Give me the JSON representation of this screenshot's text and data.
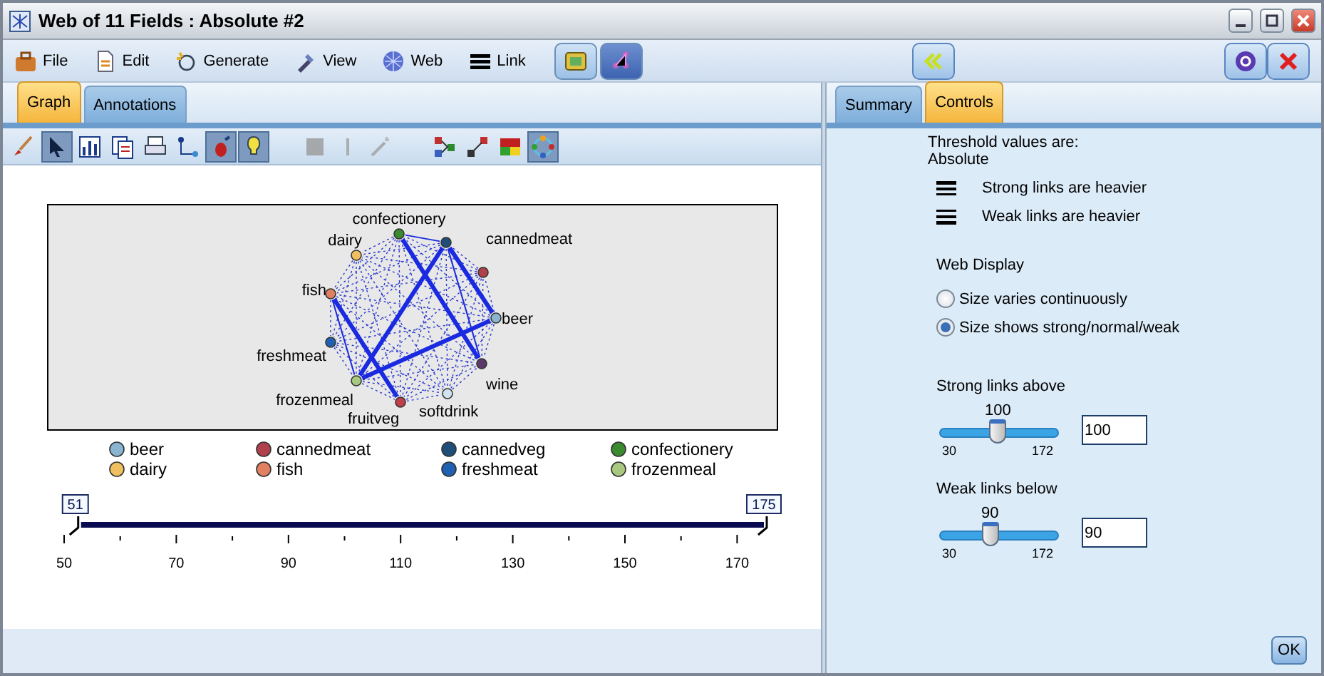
{
  "window": {
    "title": "Web of 11 Fields : Absolute #2"
  },
  "menu": [
    {
      "label": "File"
    },
    {
      "label": "Edit"
    },
    {
      "label": "Generate"
    },
    {
      "label": "View"
    },
    {
      "label": "Web"
    },
    {
      "label": "Link"
    }
  ],
  "mode_buttons": [
    {
      "selected": false
    },
    {
      "selected": true
    }
  ],
  "left_tabs": [
    {
      "label": "Graph",
      "selected": true
    },
    {
      "label": "Annotations",
      "selected": false
    }
  ],
  "graph_toolbar": [
    {
      "pressed": false
    },
    {
      "pressed": true
    },
    {
      "pressed": false
    },
    {
      "pressed": false
    },
    {
      "pressed": false
    },
    {
      "pressed": false
    },
    {
      "pressed": true
    },
    {
      "pressed": true
    },
    {
      "pressed": false,
      "disabled": true
    },
    {
      "pressed": false,
      "disabled": true
    },
    {
      "pressed": false,
      "disabled": true
    },
    {
      "pressed": false
    },
    {
      "pressed": false
    },
    {
      "pressed": false
    },
    {
      "pressed": true
    }
  ],
  "web": {
    "nodes": [
      {
        "label": "beer",
        "color": "#8ab4d0"
      },
      {
        "label": "cannedmeat",
        "color": "#b0404a"
      },
      {
        "color": "#1f4e79"
      },
      {
        "label": "confectionery",
        "color": "#3a8a2e"
      },
      {
        "label": "dairy",
        "color": "#f0c060"
      },
      {
        "label": "fish",
        "color": "#e08060"
      },
      {
        "label": "freshmeat",
        "color": "#2060b0"
      },
      {
        "label": "frozenmeal",
        "color": "#a8c880"
      },
      {
        "label": "fruitveg",
        "color": "#c0404a"
      },
      {
        "label": "softdrink",
        "color": "#d0e4f0"
      },
      {
        "label": "wine",
        "color": "#5a3a6a"
      }
    ]
  },
  "legend": [
    {
      "label": "beer",
      "color": "#8ab4d0"
    },
    {
      "label": "cannedmeat",
      "color": "#b0404a"
    },
    {
      "label": "cannedveg",
      "color": "#1f4e79"
    },
    {
      "label": "confectionery",
      "color": "#3a8a2e"
    },
    {
      "label": "dairy",
      "color": "#f0c060"
    },
    {
      "label": "fish",
      "color": "#e08060"
    },
    {
      "label": "freshmeat",
      "color": "#2060b0"
    },
    {
      "label": "frozenmeal",
      "color": "#a8c880"
    }
  ],
  "range": {
    "handles": [
      {
        "label": "51",
        "level": 0.008
      },
      {
        "label": "175",
        "level": 1.0
      }
    ],
    "ticks": [
      "50",
      "70",
      "90",
      "110",
      "130",
      "150",
      "170"
    ]
  },
  "right_tabs": [
    {
      "label": "Summary",
      "selected": false
    },
    {
      "label": "Controls",
      "selected": true
    }
  ],
  "controls": {
    "threshold_text": "Threshold values are:",
    "threshold_mode": "Absolute",
    "link_styles": [
      {
        "label": "Strong links are heavier"
      },
      {
        "label": "Weak links are heavier"
      }
    ],
    "display_heading": "Web Display",
    "display_options": [
      {
        "label": "Size varies continuously",
        "selected": false
      },
      {
        "label": "Size shows strong/normal/weak",
        "selected": true
      }
    ],
    "sliders": [
      {
        "label": "Strong links above",
        "value": "100",
        "min": "30",
        "max": "172",
        "level": 0.49,
        "input": "100"
      },
      {
        "label": "Weak links below",
        "value": "90",
        "min": "30",
        "max": "172",
        "level": 0.42,
        "input": "90"
      }
    ]
  },
  "ok_button": "OK"
}
